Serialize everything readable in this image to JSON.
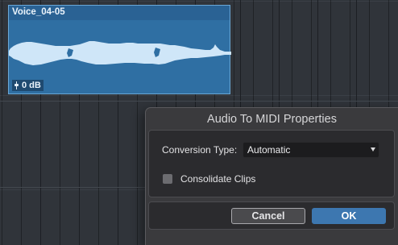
{
  "clip": {
    "name": "Voice_04-05",
    "gain": "0 dB"
  },
  "dialog": {
    "title": "Audio To MIDI Properties",
    "conversion_type_label": "Conversion Type:",
    "conversion_type_value": "Automatic",
    "consolidate_label": "Consolidate Clips",
    "consolidate_checked": false,
    "cancel_label": "Cancel",
    "ok_label": "OK"
  },
  "colors": {
    "clip": "#2f6fa3",
    "waveform": "#cfe6f8",
    "ok_button": "#3d77b0"
  },
  "icons": {
    "gain": "fader-icon",
    "dropdown": "chevron-down-icon"
  }
}
